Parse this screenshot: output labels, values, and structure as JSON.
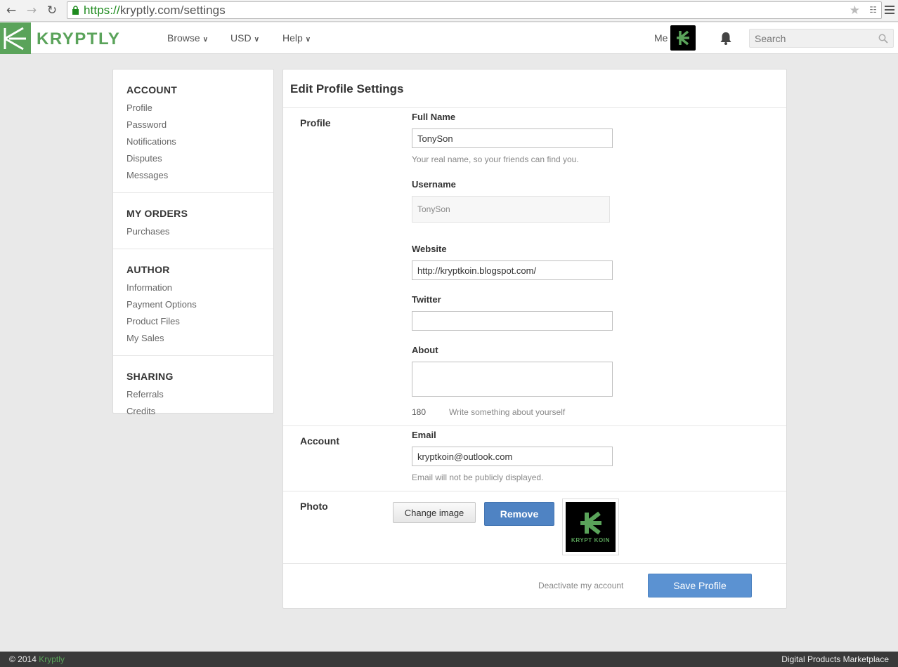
{
  "browser": {
    "url_scheme": "https://",
    "url_rest": "kryptly.com/settings"
  },
  "header": {
    "logo_text": "KRYPTLY",
    "nav": {
      "browse": "Browse",
      "currency": "USD",
      "help": "Help"
    },
    "me_label": "Me",
    "search_placeholder": "Search"
  },
  "sidebar": {
    "account": {
      "heading": "ACCOUNT",
      "items": [
        "Profile",
        "Password",
        "Notifications",
        "Disputes",
        "Messages"
      ]
    },
    "orders": {
      "heading": "MY ORDERS",
      "items": [
        "Purchases"
      ]
    },
    "author": {
      "heading": "AUTHOR",
      "items": [
        "Information",
        "Payment Options",
        "Product Files",
        "My Sales"
      ]
    },
    "sharing": {
      "heading": "SHARING",
      "items": [
        "Referrals",
        "Credits"
      ]
    }
  },
  "main": {
    "title": "Edit Profile Settings",
    "profile_section": "Profile",
    "full_name_label": "Full Name",
    "full_name_value": "TonySon",
    "full_name_help": "Your real name, so your friends can find you.",
    "username_label": "Username",
    "username_value": "TonySon",
    "website_label": "Website",
    "website_value": "http://kryptkoin.blogspot.com/",
    "twitter_label": "Twitter",
    "twitter_value": "",
    "about_label": "About",
    "about_value": "",
    "about_counter": "180",
    "about_help": "Write something about yourself",
    "account_section": "Account",
    "email_label": "Email",
    "email_value": "kryptkoin@outlook.com",
    "email_help": "Email will not be publicly displayed.",
    "photo_section": "Photo",
    "change_image_label": "Change image",
    "remove_label": "Remove",
    "photo_caption": "KRYPT KOIN",
    "deactivate_label": "Deactivate my account",
    "save_label": "Save Profile"
  },
  "footer": {
    "copyright": "© 2014",
    "brand": "Kryptly",
    "tagline": "Digital Products Marketplace"
  },
  "colors": {
    "brand_green": "#5aa35a",
    "primary_blue": "#4f83c3"
  }
}
